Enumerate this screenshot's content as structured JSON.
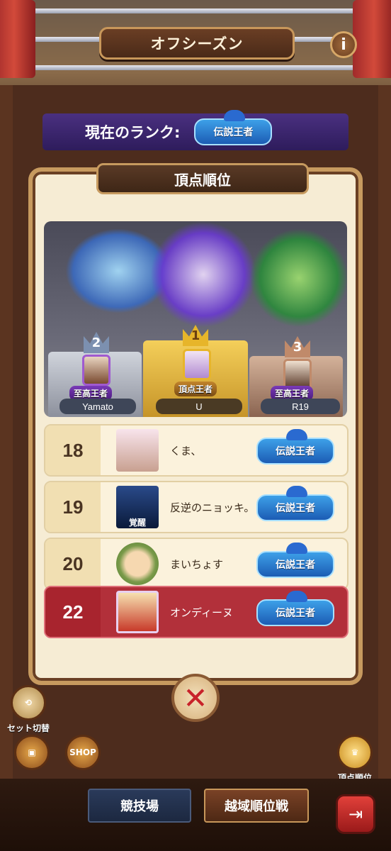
{
  "header": {
    "title": "オフシーズン",
    "info_icon": "i"
  },
  "current_rank": {
    "label": "現在のランク:",
    "rank": "伝説王者"
  },
  "panel": {
    "tab_title": "頂点順位"
  },
  "top_three": [
    {
      "place": "2",
      "title": "至高王者",
      "name": "Yamato"
    },
    {
      "place": "1",
      "title": "頂点王者",
      "name": "U"
    },
    {
      "place": "3",
      "title": "至高王者",
      "name": "R19"
    }
  ],
  "rankings": [
    {
      "rank": "18",
      "name": "くま、",
      "tier": "伝説王者"
    },
    {
      "rank": "19",
      "name": "反逆のニョッキ。",
      "tier": "伝説王者",
      "avatar_text": "覚醒"
    },
    {
      "rank": "20",
      "name": "まいちょす",
      "tier": "伝説王者"
    },
    {
      "rank": "22",
      "name": "オンディーヌ",
      "tier": "伝説王者",
      "is_self": true
    }
  ],
  "close_icon": "✕",
  "bottom": {
    "set_switch": "セット切替",
    "shop": "SHOP",
    "apex_rank": "頂点順位",
    "tab_arena": "競技場",
    "tab_cross": "越域順位戦",
    "exit_icon": "⇥"
  }
}
